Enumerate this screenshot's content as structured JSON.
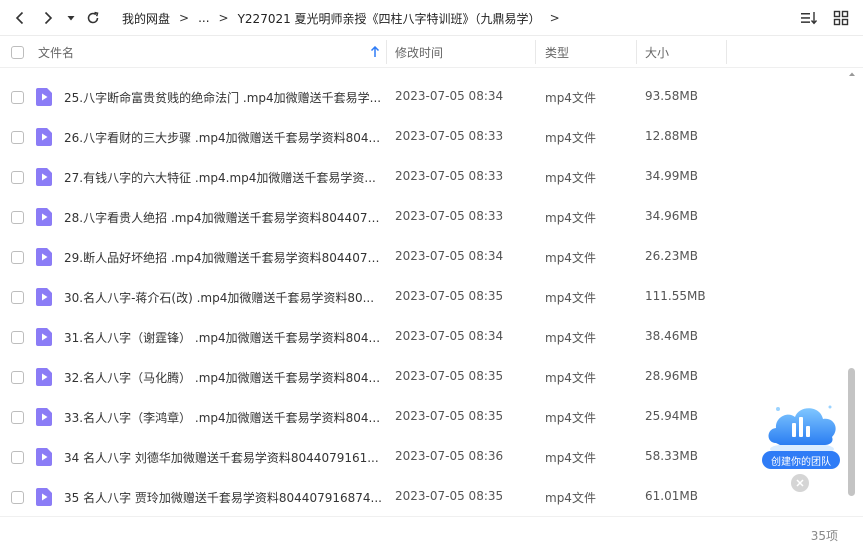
{
  "breadcrumb": {
    "root": "我的网盘",
    "ellipsis": "...",
    "current": "Y227021 夏光明师亲授《四柱八字特训班》（九鼎易学）"
  },
  "columns": {
    "name": "文件名",
    "modified": "修改时间",
    "type": "类型",
    "size": "大小"
  },
  "files": [
    {
      "name": "25.八字断命富贵贫贱的绝命法门 .mp4加微赠送千套易学...",
      "modified": "2023-07-05 08:34",
      "type": "mp4文件",
      "size": "93.58MB"
    },
    {
      "name": "26.八字看财的三大步骤 .mp4加微赠送千套易学资料804...",
      "modified": "2023-07-05 08:33",
      "type": "mp4文件",
      "size": "12.88MB"
    },
    {
      "name": "27.有钱八字的六大特征 .mp4.mp4加微赠送千套易学资...",
      "modified": "2023-07-05 08:33",
      "type": "mp4文件",
      "size": "34.99MB"
    },
    {
      "name": "28.八字看贵人绝招 .mp4加微赠送千套易学资料8044079...",
      "modified": "2023-07-05 08:33",
      "type": "mp4文件",
      "size": "34.96MB"
    },
    {
      "name": "29.断人品好坏绝招 .mp4加微赠送千套易学资料8044079...",
      "modified": "2023-07-05 08:34",
      "type": "mp4文件",
      "size": "26.23MB"
    },
    {
      "name": "30.名人八字-蒋介石(改)  .mp4加微赠送千套易学资料80...",
      "modified": "2023-07-05 08:35",
      "type": "mp4文件",
      "size": "111.55MB"
    },
    {
      "name": "31.名人八字（谢霆锋）  .mp4加微赠送千套易学资料804...",
      "modified": "2023-07-05 08:34",
      "type": "mp4文件",
      "size": "38.46MB"
    },
    {
      "name": "32.名人八字（马化腾）  .mp4加微赠送千套易学资料804...",
      "modified": "2023-07-05 08:35",
      "type": "mp4文件",
      "size": "28.96MB"
    },
    {
      "name": "33.名人八字（李鸿章）  .mp4加微赠送千套易学资料804...",
      "modified": "2023-07-05 08:35",
      "type": "mp4文件",
      "size": "25.94MB"
    },
    {
      "name": "34 名人八字  刘德华加微赠送千套易学资料8044079161...",
      "modified": "2023-07-05 08:36",
      "type": "mp4文件",
      "size": "58.33MB"
    },
    {
      "name": "35  名人八字  贾玲加微赠送千套易学资料804407916874...",
      "modified": "2023-07-05 08:35",
      "type": "mp4文件",
      "size": "61.01MB"
    }
  ],
  "footer": {
    "count": "35项"
  },
  "team_widget": {
    "label": "创建你的团队"
  },
  "colors": {
    "accent": "#2f7cf6",
    "video_icon": "#8b7cf6"
  }
}
